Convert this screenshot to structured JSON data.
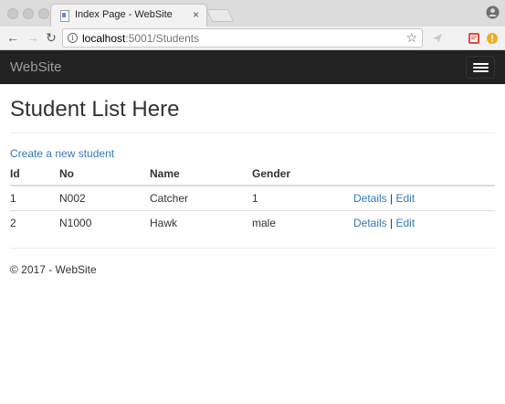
{
  "browser": {
    "tab_title": "Index Page - WebSite",
    "tab_close": "×",
    "url_host": "localhost",
    "url_path": ":5001/Students",
    "icons": [
      "back-icon",
      "forward-icon",
      "reload-icon",
      "info-icon",
      "star-icon",
      "profile-icon"
    ]
  },
  "navbar": {
    "brand": "WebSite"
  },
  "page": {
    "title": "Student List Here",
    "create_link": "Create a new student",
    "table": {
      "headers": [
        "Id",
        "No",
        "Name",
        "Gender"
      ],
      "rows": [
        {
          "id": "1",
          "no": "N002",
          "name": "Catcher",
          "gender": "1",
          "details": "Details",
          "separator": "|",
          "edit": "Edit"
        },
        {
          "id": "2",
          "no": "N1000",
          "name": "Hawk",
          "gender": "male",
          "details": "Details",
          "separator": "|",
          "edit": "Edit"
        }
      ]
    },
    "footer": "© 2017 - WebSite"
  },
  "colors": {
    "navbar_bg": "#222222",
    "brand_text": "#9d9d9d",
    "link": "#337ab7"
  }
}
